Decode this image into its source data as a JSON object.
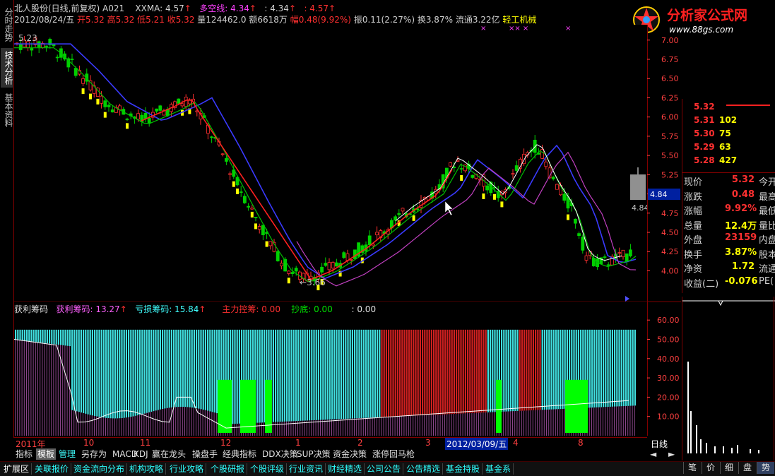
{
  "sidebar": {
    "tabs": [
      {
        "label": "分时走势",
        "active": false
      },
      {
        "label": "技术分析",
        "active": true
      },
      {
        "label": "基本资料",
        "active": false
      }
    ]
  },
  "header": {
    "stock": "北人股份(日线,前复权) A021",
    "xxma_label": "XXMA: 4.57",
    "duokong_label": "多空线: 4.34",
    "v434": ": 4.34",
    "v457": ": 4.57",
    "date": "2012/08/24/五",
    "open": "开5.32",
    "high": "高5.32",
    "low": "低5.21",
    "close": "收5.32",
    "volume": "量124462.0",
    "amount": "额6618万",
    "change": "幅0.48(9.92%)",
    "amplitude": "振0.11(2.27%)",
    "turnover": "换3.87%",
    "float": "流通3.22亿",
    "industry": "轻工机械",
    "ma_label": "5.23"
  },
  "logo": {
    "text": "分析家公式网",
    "url": "www.88gs.com"
  },
  "main_chart": {
    "y_ticks": [
      "7.00",
      "6.75",
      "6.50",
      "6.25",
      "6.00",
      "5.75",
      "5.50",
      "5.25",
      "5.00",
      "4.75",
      "4.50",
      "4.25",
      "4.00"
    ],
    "ylim": [
      3.6,
      7.2
    ],
    "last_price_label": "4.84",
    "price_tag": "4.84",
    "low_label": "3.66",
    "colors": {
      "up": "#ff3030",
      "down": "#00d000",
      "ma_blue": "#3030ff",
      "ma_green": "#00c000",
      "ma_magenta": "#c040c0",
      "ma_white": "#ffffff"
    }
  },
  "indicator": {
    "labels": [
      {
        "text": "获利筹码",
        "color": "#e0e0e0"
      },
      {
        "text": "获利筹码: 13.27",
        "color": "#ff60ff"
      },
      {
        "text": "亏损筹码: 15.84",
        "color": "#40ffff"
      },
      {
        "text": "主力控筹: 0.00",
        "color": "#ff3030"
      },
      {
        "text": "抄底: 0.00",
        "color": "#00e000"
      },
      {
        "text": ": 0.00",
        "color": "#e0e0e0"
      }
    ],
    "y_ticks": [
      "60.00",
      "50.00",
      "40.00",
      "30.00",
      "20.00",
      "10.00"
    ],
    "ylim": [
      0,
      63
    ]
  },
  "order_book": [
    {
      "price": "5.32",
      "vol": ""
    },
    {
      "price": "5.31",
      "vol": "102"
    },
    {
      "price": "5.30",
      "vol": "75"
    },
    {
      "price": "5.29",
      "vol": "63"
    },
    {
      "price": "5.28",
      "vol": "427"
    }
  ],
  "quote": [
    {
      "label": "现价",
      "value": "5.32",
      "extra": "今开",
      "color": "#ff3030"
    },
    {
      "label": "涨跌",
      "value": "0.48",
      "extra": "最高",
      "color": "#ff3030"
    },
    {
      "label": "涨幅",
      "value": "9.92%",
      "extra": "最低",
      "color": "#ff3030"
    },
    {
      "label": "总量",
      "value": "12.4万",
      "extra": "量比",
      "color": "#ffff00"
    },
    {
      "label": "外盘",
      "value": "23159",
      "extra": "内盘",
      "color": "#ff3030"
    },
    {
      "label": "换手",
      "value": "3.87%",
      "extra": "股本",
      "color": "#ffff00"
    },
    {
      "label": "净资",
      "value": "1.72",
      "extra": "流通",
      "color": "#ffff00"
    },
    {
      "label": "收益(二)",
      "value": "-0.076",
      "extra": "PE(",
      "color": "#ffff00"
    }
  ],
  "time_axis": {
    "labels": [
      "2011年",
      "10",
      "11",
      "12",
      "1",
      "2",
      "3",
      "4",
      "8"
    ],
    "selected_date": "2012/03/09/五",
    "period": "日线"
  },
  "tabs_row": [
    "指标",
    "模板",
    "管理",
    "另存为",
    "MACD",
    "KDJ",
    "赢在龙头",
    "操盘手",
    "经典指标",
    "DDX决策",
    "SUP决策",
    "资金决策",
    "涨停回马枪"
  ],
  "bottom_bar": [
    "扩展区",
    "关联报价",
    "资金流向分布",
    "机构攻略",
    "行业攻略",
    "个股研报",
    "个股评级",
    "行业资讯",
    "财经精选",
    "公司公告",
    "公告精选",
    "基金持股",
    "基金系"
  ],
  "mini_tabs": [
    "笔",
    "价",
    "细",
    "盘",
    "势"
  ]
}
